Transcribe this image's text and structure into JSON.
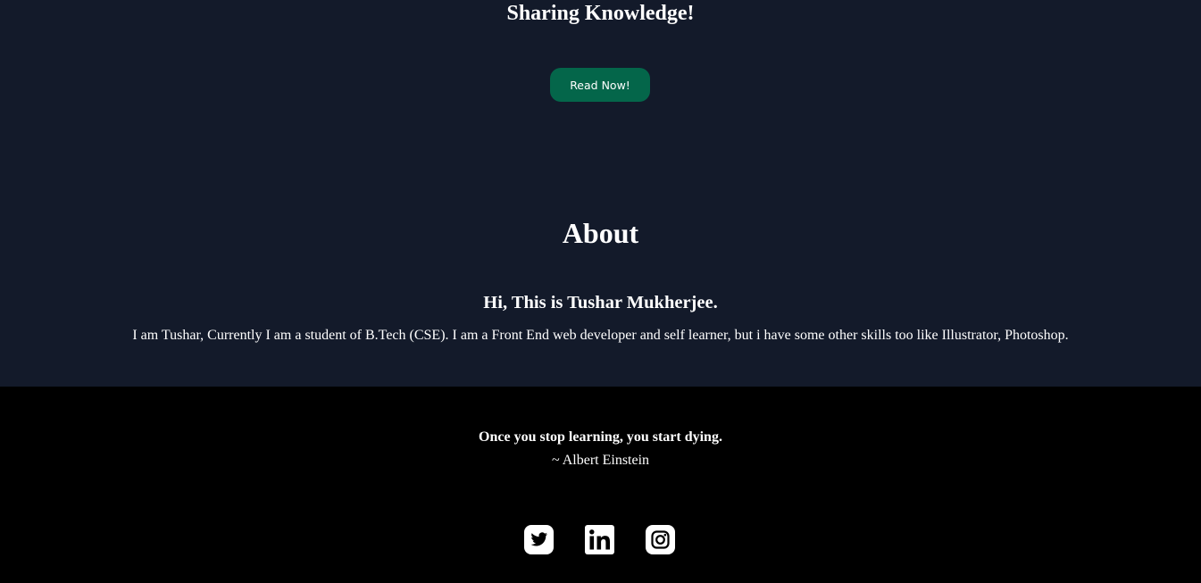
{
  "hero": {
    "title": "Sharing Knowledge!",
    "button_label": "Read Now!"
  },
  "about": {
    "heading": "About",
    "subheading": "Hi, This is Tushar Mukherjee.",
    "text": "I am Tushar, Currently I am a student of B.Tech (CSE). I am a Front End web developer and self learner, but i have some other skills too like Illustrator, Photoshop."
  },
  "footer": {
    "quote": "Once you stop learning, you start dying.",
    "author": "~ Albert Einstein",
    "social_icons": [
      "twitter-icon",
      "linkedin-icon",
      "instagram-icon"
    ]
  },
  "colors": {
    "page_background": "#131a2a",
    "footer_background": "#000000",
    "button_background": "#04664a",
    "text": "#ffffff"
  }
}
